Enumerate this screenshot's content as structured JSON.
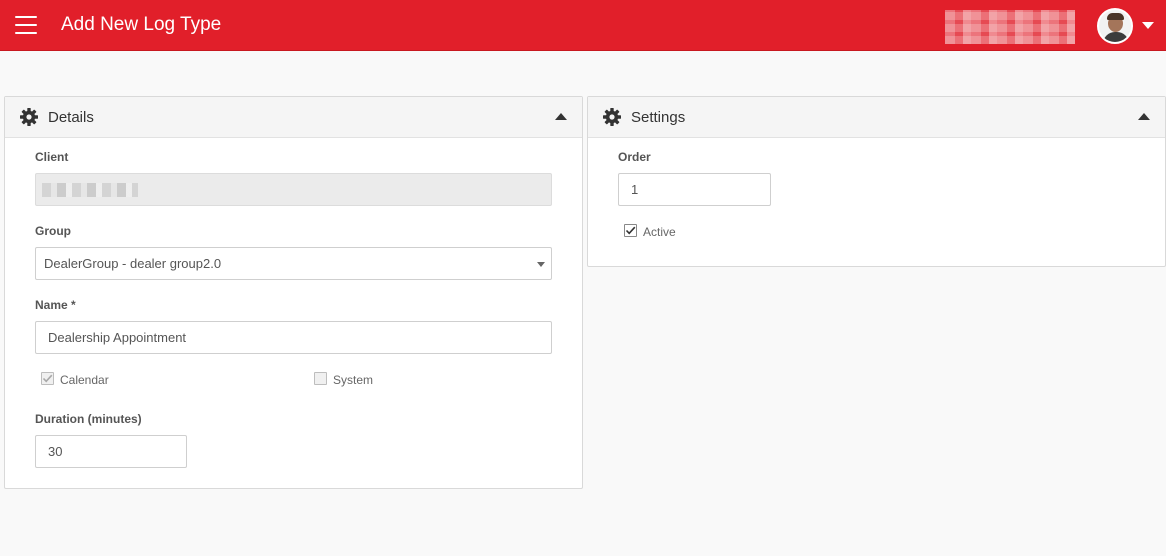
{
  "header": {
    "menu_icon": "hamburger-menu-icon",
    "title": "Add New Log Type",
    "user_menu_icon": "chevron-down-icon",
    "colors": {
      "bar": "#e11f2a",
      "text": "#ffffff"
    }
  },
  "details": {
    "title": "Details",
    "icon": "gear-icon",
    "client_label": "Client",
    "client_value": "",
    "group_label": "Group",
    "group_value": "DealerGroup - dealer group2.0",
    "name_label": "Name *",
    "name_value": "Dealership Appointment",
    "calendar_label": "Calendar",
    "calendar_checked": true,
    "system_label": "System",
    "system_checked": false,
    "duration_label": "Duration (minutes)",
    "duration_value": "30"
  },
  "settings": {
    "title": "Settings",
    "icon": "gear-icon",
    "order_label": "Order",
    "order_value": "1",
    "active_label": "Active",
    "active_checked": true
  }
}
